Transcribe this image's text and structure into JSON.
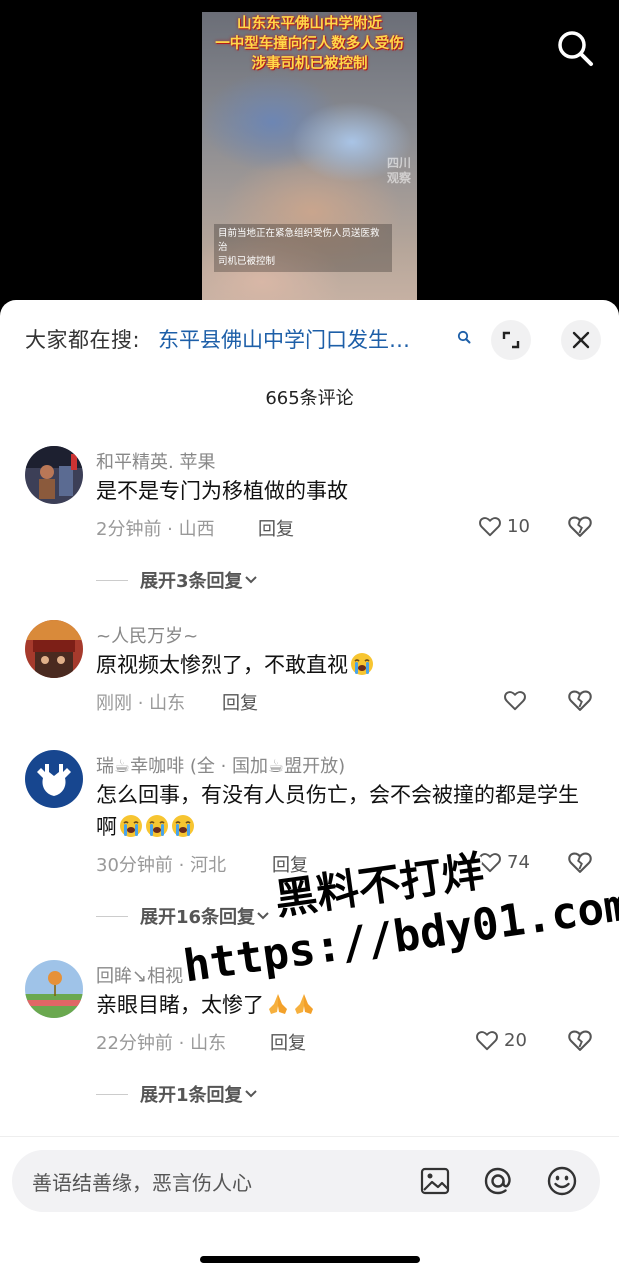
{
  "video": {
    "headline": [
      "山东东平佛山中学附近",
      "一中型车撞向行人数多人受伤",
      "涉事司机已被控制"
    ],
    "caption": "目前当地正在紧急组织受伤人员送医救治\n司机已被控制",
    "watermark": "四川观察"
  },
  "search": {
    "prefix": "大家都在搜:",
    "query": "东平县佛山中学门口发生…"
  },
  "comment_count": "665条评论",
  "comments": [
    {
      "name": "和平精英. 苹果",
      "text": "是不是专门为移植做的事故",
      "time_location": "2分钟前 · 山西",
      "reply_label": "回复",
      "likes": "10",
      "expand": "展开3条回复"
    },
    {
      "name": "~人民万岁~",
      "text": "原视频太惨烈了，不敢直视",
      "emoji": [
        "loudly-crying-face"
      ],
      "time_location": "刚刚 · 山东",
      "reply_label": "回复",
      "likes": ""
    },
    {
      "name": "瑞☕幸咖啡 (全 · 国加☕盟开放)",
      "text": "怎么回事，有没有人员伤亡，会不会被撞的都是学生啊",
      "emoji": [
        "loudly-crying-face",
        "loudly-crying-face",
        "loudly-crying-face"
      ],
      "time_location": "30分钟前 · 河北",
      "reply_label": "回复",
      "likes": "74",
      "expand": "展开16条回复"
    },
    {
      "name": "回眸↘相视",
      "text": "亲眼目睹，太惨了",
      "emoji": [
        "folded-hands",
        "folded-hands"
      ],
      "time_location": "22分钟前 · 山东",
      "reply_label": "回复",
      "likes": "20",
      "expand": "展开1条回复"
    }
  ],
  "overlay_watermark": {
    "line1": "黑料不打烊",
    "line2": "https://bdy01.com"
  },
  "input": {
    "placeholder": "善语结善缘，恶言伤人心"
  },
  "icons": {
    "search": "search-icon",
    "expand_fullscreen": "expand-icon",
    "close": "close-icon",
    "like": "heart-outline-icon",
    "dislike": "broken-heart-icon",
    "chevron": "chevron-down-icon",
    "image": "image-icon",
    "mention": "at-icon",
    "emoji_picker": "smiley-icon"
  },
  "colors": {
    "query_link": "#1d5fa8",
    "sheet_bg": "#ffffff",
    "input_bg": "#f2f2f4"
  }
}
